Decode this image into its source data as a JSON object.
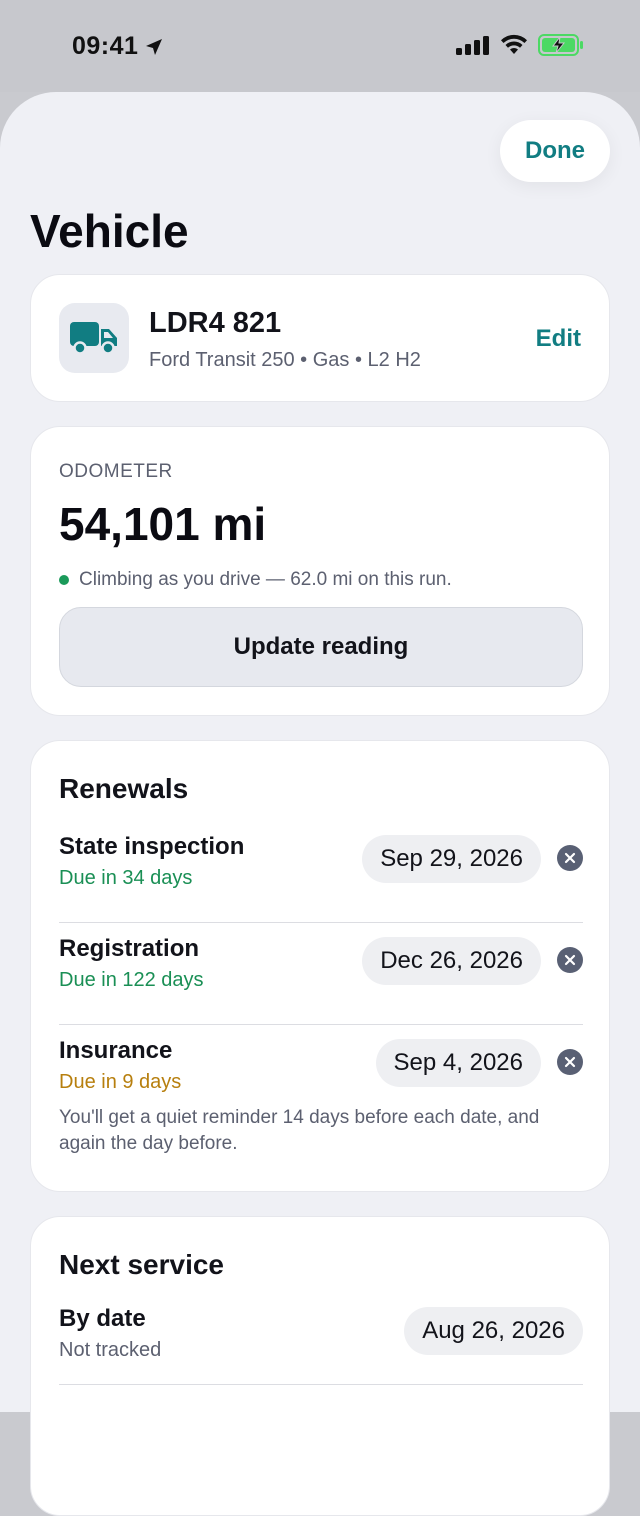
{
  "status": {
    "time": "09:41"
  },
  "header": {
    "done_label": "Done",
    "title": "Vehicle"
  },
  "vehicle": {
    "plate": "LDR4 821",
    "description": "Ford Transit 250 • Gas • L2 H2",
    "edit_label": "Edit",
    "icon": "truck-icon"
  },
  "odometer": {
    "label": "ODOMETER",
    "value": "54,101 mi",
    "note": "Climbing as you drive — 62.0 mi on this run.",
    "update_label": "Update reading"
  },
  "renewals": {
    "title": "Renewals",
    "items": [
      {
        "name": "State inspection",
        "due": "Due in 34 days",
        "date": "Sep 29, 2026",
        "status_color": "#1a8f55"
      },
      {
        "name": "Registration",
        "due": "Due in 122 days",
        "date": "Dec 26, 2026",
        "status_color": "#1a8f55"
      },
      {
        "name": "Insurance",
        "due": "Due in 9 days",
        "date": "Sep 4, 2026",
        "status_color": "#b77f0e"
      }
    ],
    "note": "You'll get a quiet reminder 14 days before each date, and again the day before."
  },
  "service": {
    "title": "Next service",
    "items": [
      {
        "name": "By date",
        "sub": "Not tracked",
        "date": "Aug 26, 2026"
      }
    ]
  },
  "colors": {
    "accent": "#117d82",
    "battery": "#4cd964"
  }
}
